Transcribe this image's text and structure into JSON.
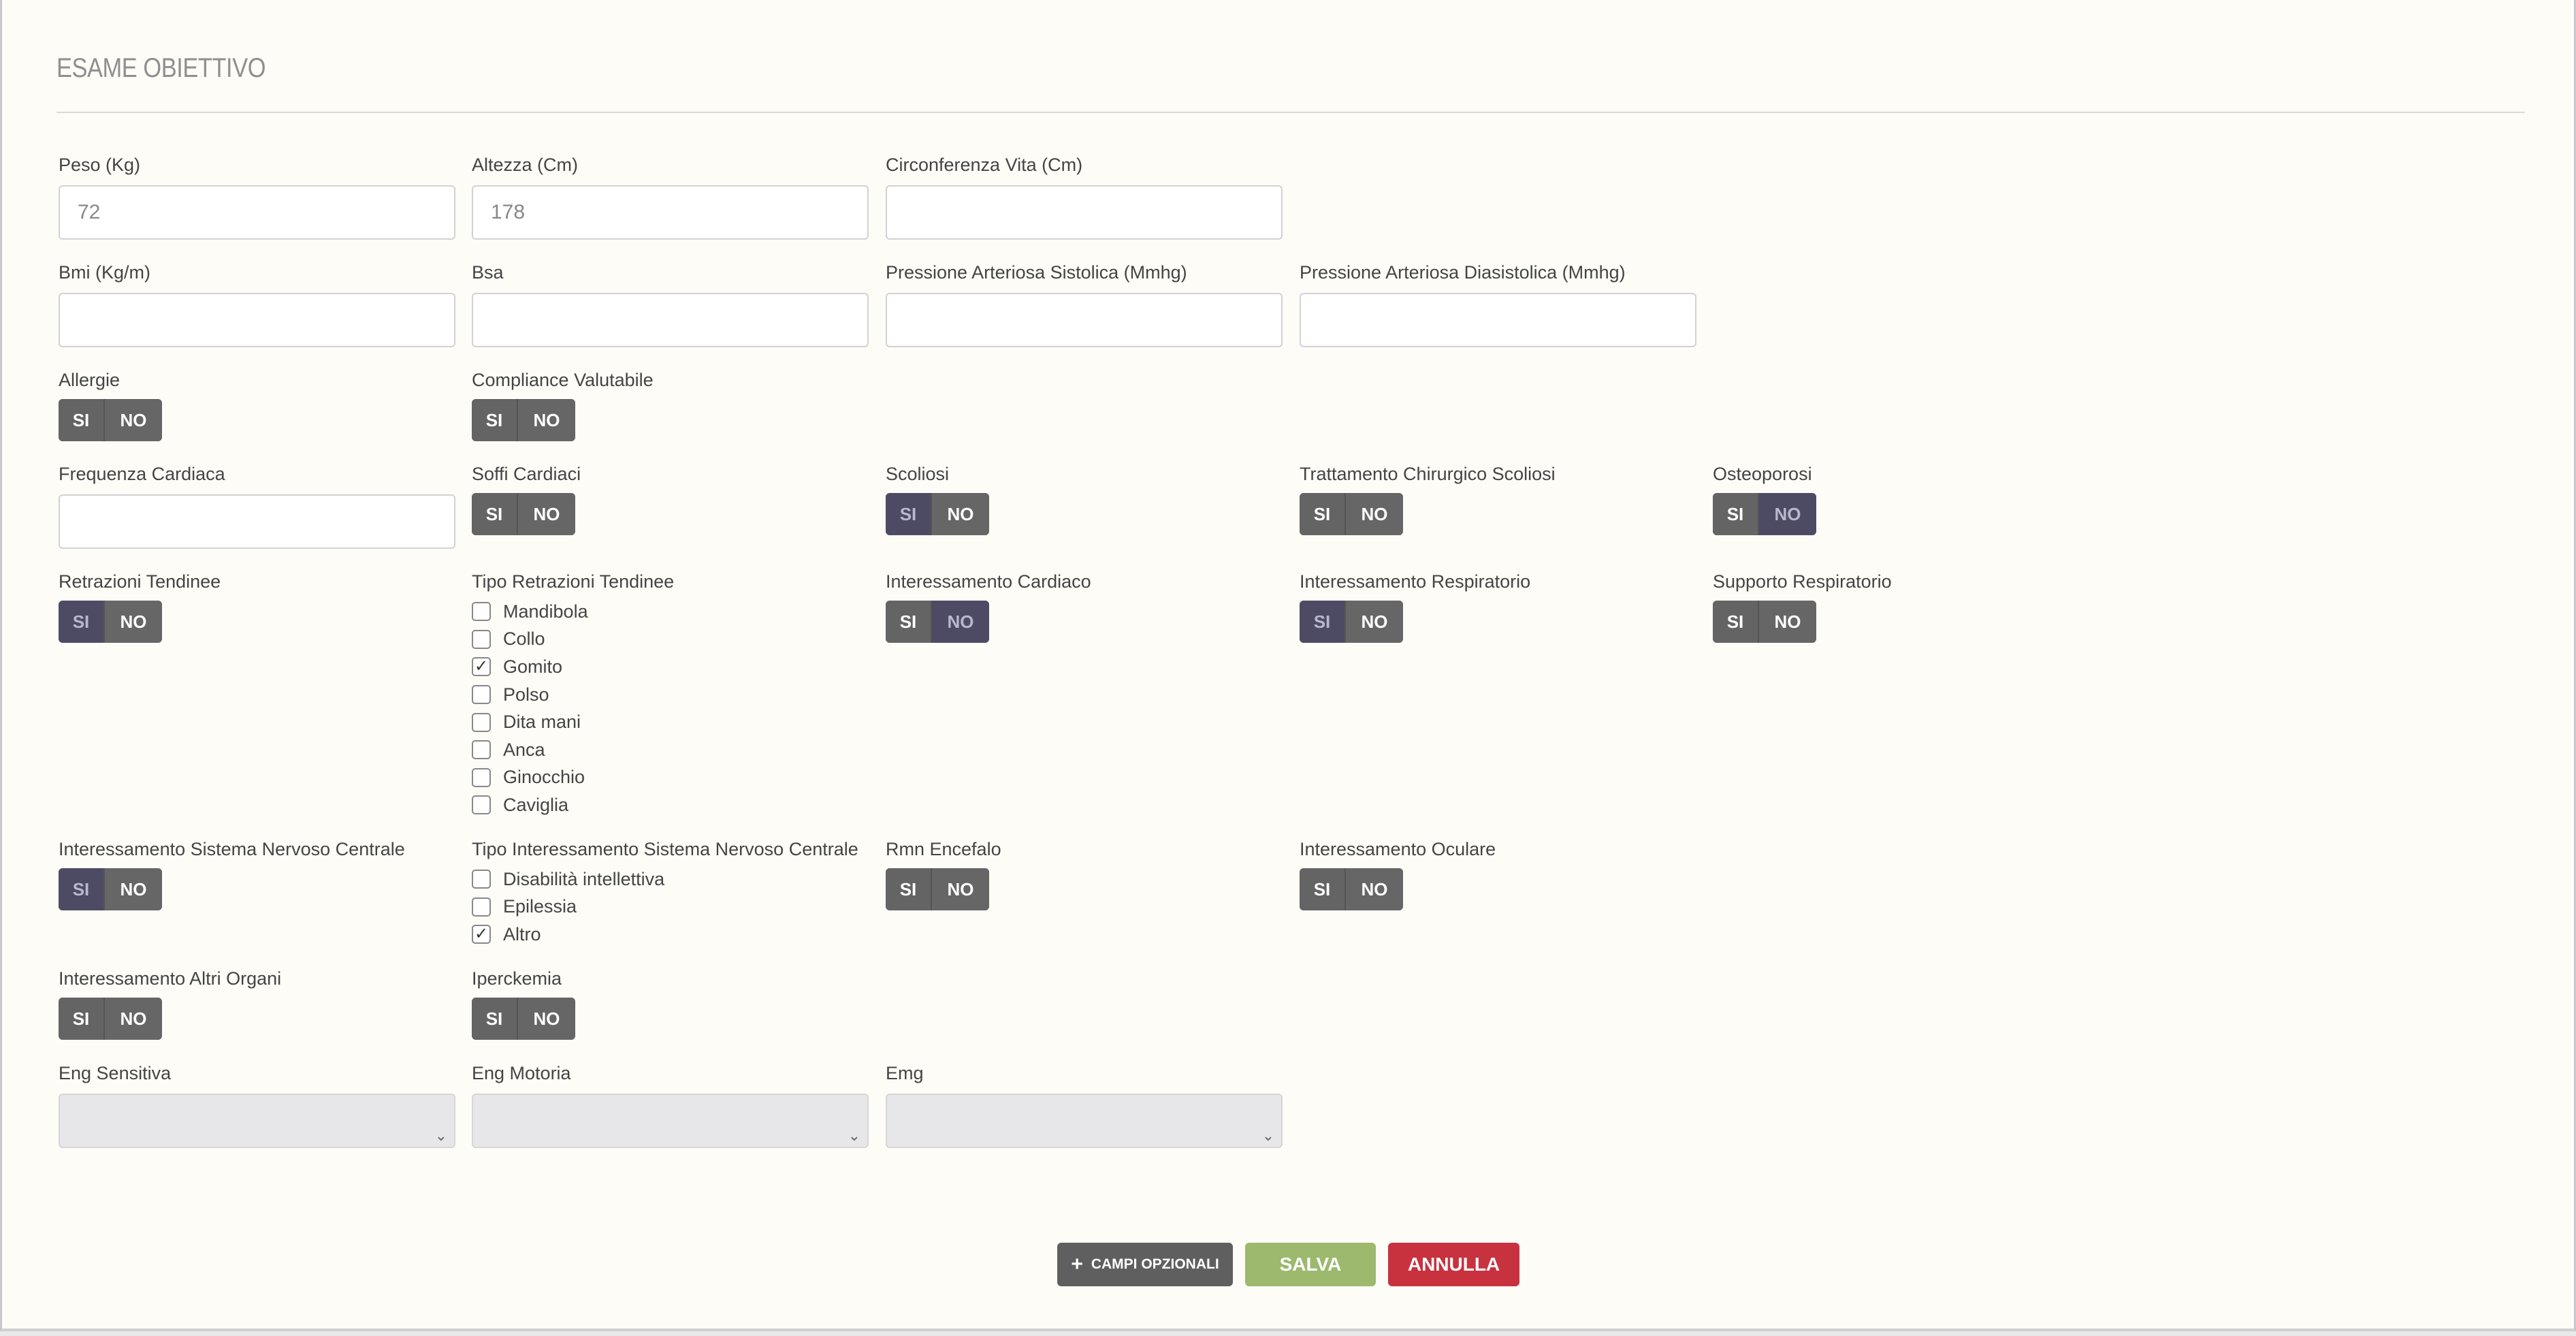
{
  "section": {
    "title": "ESAME OBIETTIVO"
  },
  "fields": {
    "peso": {
      "label": "Peso (Kg)",
      "value": "72"
    },
    "altezza": {
      "label": "Altezza (Cm)",
      "value": "178"
    },
    "circonferenza": {
      "label": "Circonferenza Vita (Cm)",
      "value": ""
    },
    "bmi": {
      "label": "Bmi (Kg/m)",
      "value": ""
    },
    "bsa": {
      "label": "Bsa",
      "value": ""
    },
    "sistolica": {
      "label": "Pressione Arteriosa Sistolica (Mmhg)",
      "value": ""
    },
    "diastolica": {
      "label": "Pressione Arteriosa Diasistolica (Mmhg)",
      "value": ""
    },
    "frequenza": {
      "label": "Frequenza Cardiaca",
      "value": ""
    }
  },
  "toggle_labels": {
    "si": "SI",
    "no": "NO"
  },
  "toggles": {
    "allergie": {
      "label": "Allergie",
      "selected": "none"
    },
    "compliance": {
      "label": "Compliance Valutabile",
      "selected": "none"
    },
    "soffi": {
      "label": "Soffi Cardiaci",
      "selected": "none"
    },
    "scoliosi": {
      "label": "Scoliosi",
      "selected": "si"
    },
    "trattamento": {
      "label": "Trattamento Chirurgico Scoliosi",
      "selected": "none"
    },
    "osteoporosi": {
      "label": "Osteoporosi",
      "selected": "no"
    },
    "retrazioni": {
      "label": "Retrazioni Tendinee",
      "selected": "si"
    },
    "cardiaco": {
      "label": "Interessamento Cardiaco",
      "selected": "no"
    },
    "respiratorio": {
      "label": "Interessamento Respiratorio",
      "selected": "si"
    },
    "supporto": {
      "label": "Supporto Respiratorio",
      "selected": "none"
    },
    "snc": {
      "label": "Interessamento Sistema Nervoso Centrale",
      "selected": "si"
    },
    "rmn": {
      "label": "Rmn Encefalo",
      "selected": "none"
    },
    "oculare": {
      "label": "Interessamento Oculare",
      "selected": "none"
    },
    "altri_organi": {
      "label": "Interessamento Altri Organi",
      "selected": "none"
    },
    "iperckemia": {
      "label": "Iperckemia",
      "selected": "none"
    }
  },
  "tipo_retrazioni": {
    "label": "Tipo Retrazioni Tendinee",
    "options": [
      {
        "label": "Mandibola",
        "checked": false
      },
      {
        "label": "Collo",
        "checked": false
      },
      {
        "label": "Gomito",
        "checked": true
      },
      {
        "label": "Polso",
        "checked": false
      },
      {
        "label": "Dita mani",
        "checked": false
      },
      {
        "label": "Anca",
        "checked": false
      },
      {
        "label": "Ginocchio",
        "checked": false
      },
      {
        "label": "Caviglia",
        "checked": false
      }
    ]
  },
  "tipo_snc": {
    "label": "Tipo Interessamento Sistema Nervoso Centrale",
    "options": [
      {
        "label": "Disabilità intellettiva",
        "checked": false
      },
      {
        "label": "Epilessia",
        "checked": false
      },
      {
        "label": "Altro",
        "checked": true
      }
    ]
  },
  "selects": {
    "eng_sensitiva": {
      "label": "Eng Sensitiva",
      "value": ""
    },
    "eng_motoria": {
      "label": "Eng Motoria",
      "value": ""
    },
    "emg": {
      "label": "Emg",
      "value": ""
    }
  },
  "buttons": {
    "optional": "CAMPI OPZIONALI",
    "save": "SALVA",
    "cancel": "ANNULLA"
  }
}
